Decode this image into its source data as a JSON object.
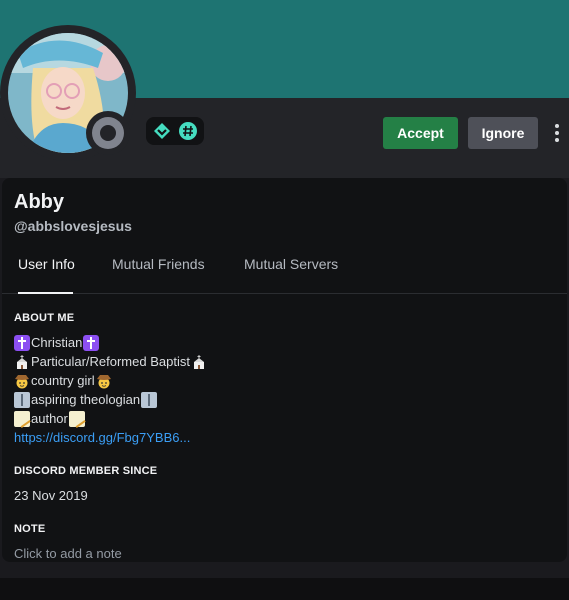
{
  "profile": {
    "display_name": "Abby",
    "username": "@abbslovesjesus",
    "status": "offline"
  },
  "colors": {
    "banner": "#1e7472",
    "accept": "#248046",
    "ignore": "#4e5058",
    "link": "#3b9ef5"
  },
  "actions": {
    "accept_label": "Accept",
    "ignore_label": "Ignore"
  },
  "badges": [
    "hypesquad-balance-icon",
    "hashtag-icon"
  ],
  "tabs": [
    {
      "label": "User Info",
      "active": true
    },
    {
      "label": "Mutual Friends",
      "active": false
    },
    {
      "label": "Mutual Servers",
      "active": false
    }
  ],
  "about": {
    "title": "ABOUT ME",
    "lines": [
      {
        "emoji": "latin-cross-icon",
        "text": "Christian"
      },
      {
        "emoji": "church-icon",
        "text": "Particular/Reformed Baptist"
      },
      {
        "emoji": "cowboy-face-icon",
        "text": "country girl"
      },
      {
        "emoji": "open-book-icon",
        "text": "aspiring theologian"
      },
      {
        "emoji": "memo-icon",
        "text": "author"
      }
    ],
    "link": "https://discord.gg/Fbg7YBB6..."
  },
  "member_since": {
    "title": "DISCORD MEMBER SINCE",
    "date": "23 Nov 2019"
  },
  "note": {
    "title": "NOTE",
    "placeholder": "Click to add a note"
  }
}
